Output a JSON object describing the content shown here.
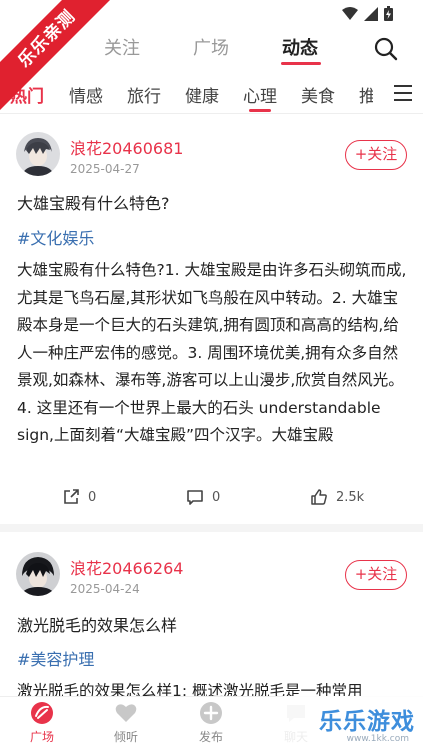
{
  "ribbon_text": "乐乐亲测",
  "top_tabs": [
    "关注",
    "广场",
    "动态"
  ],
  "categories": [
    "热门",
    "情感",
    "旅行",
    "健康",
    "心理",
    "美食",
    "推"
  ],
  "posts": [
    {
      "username": "浪花20460681",
      "date": "2025-04-27",
      "follow_label": "+关注",
      "title": "大雄宝殿有什么特色?",
      "tag": "#文化娱乐",
      "body": "大雄宝殿有什么特色?1. 大雄宝殿是由许多石头砌筑而成,尤其是飞鸟石屋,其形状如飞鸟般在风中转动。2. 大雄宝殿本身是一个巨大的石头建筑,拥有圆顶和高高的结构,给人一种庄严宏伟的感觉。3. 周围环境优美,拥有众多自然景观,如森林、瀑布等,游客可以上山漫步,欣赏自然风光。4. 这里还有一个世界上最大的石头 understandable sign,上面刻着“大雄宝殿”四个汉字。大雄宝殿",
      "shares": "0",
      "comments": "0",
      "likes": "2.5k"
    },
    {
      "username": "浪花20466264",
      "date": "2025-04-24",
      "follow_label": "+关注",
      "title": "激光脱毛的效果怎么样",
      "tag": "#美容护理",
      "body": "激光脱毛的效果怎么样1: 概述激光脱毛是一种常用"
    }
  ],
  "bottom_nav": [
    "广场",
    "倾听",
    "发布",
    "聊天"
  ],
  "watermark": {
    "brand": "乐乐游戏",
    "url": "www.1kk.com"
  },
  "colors": {
    "accent": "#e8334a",
    "tag": "#3a6fb0",
    "ribbon": "#e0212f"
  }
}
